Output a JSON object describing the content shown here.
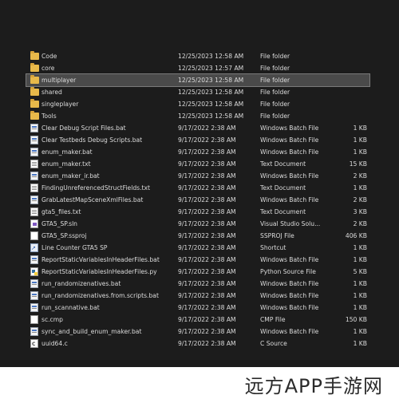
{
  "files": [
    {
      "name": "Code",
      "date": "12/25/2023 12:58 AM",
      "type": "File folder",
      "size": "",
      "icon": "folder-icon"
    },
    {
      "name": "core",
      "date": "12/25/2023 12:57 AM",
      "type": "File folder",
      "size": "",
      "icon": "folder-icon"
    },
    {
      "name": "multiplayer",
      "date": "12/25/2023 12:58 AM",
      "type": "File folder",
      "size": "",
      "icon": "folder-icon",
      "selected": true
    },
    {
      "name": "shared",
      "date": "12/25/2023 12:58 AM",
      "type": "File folder",
      "size": "",
      "icon": "folder-icon"
    },
    {
      "name": "singleplayer",
      "date": "12/25/2023 12:58 AM",
      "type": "File folder",
      "size": "",
      "icon": "folder-icon"
    },
    {
      "name": "Tools",
      "date": "12/25/2023 12:58 AM",
      "type": "File folder",
      "size": "",
      "icon": "folder-icon"
    },
    {
      "name": "Clear Debug Script Files.bat",
      "date": "9/17/2022 2:38 AM",
      "type": "Windows Batch File",
      "size": "1 KB",
      "icon": "batch-file-icon"
    },
    {
      "name": "Clear Testbeds Debug Scripts.bat",
      "date": "9/17/2022 2:38 AM",
      "type": "Windows Batch File",
      "size": "1 KB",
      "icon": "batch-file-icon"
    },
    {
      "name": "enum_maker.bat",
      "date": "9/17/2022 2:38 AM",
      "type": "Windows Batch File",
      "size": "1 KB",
      "icon": "batch-file-icon"
    },
    {
      "name": "enum_maker.txt",
      "date": "9/17/2022 2:38 AM",
      "type": "Text Document",
      "size": "15 KB",
      "icon": "text-file-icon"
    },
    {
      "name": "enum_maker_ir.bat",
      "date": "9/17/2022 2:38 AM",
      "type": "Windows Batch File",
      "size": "2 KB",
      "icon": "batch-file-icon"
    },
    {
      "name": "FindingUnreferencedStructFields.txt",
      "date": "9/17/2022 2:38 AM",
      "type": "Text Document",
      "size": "1 KB",
      "icon": "text-file-icon"
    },
    {
      "name": "GrabLatestMapSceneXmlFiles.bat",
      "date": "9/17/2022 2:38 AM",
      "type": "Windows Batch File",
      "size": "2 KB",
      "icon": "batch-file-icon"
    },
    {
      "name": "gta5_files.txt",
      "date": "9/17/2022 2:38 AM",
      "type": "Text Document",
      "size": "3 KB",
      "icon": "text-file-icon"
    },
    {
      "name": "GTA5_SP.sln",
      "date": "9/17/2022 2:38 AM",
      "type": "Visual Studio Solu...",
      "size": "2 KB",
      "icon": "solution-file-icon"
    },
    {
      "name": "GTA5_SP.ssproj",
      "date": "9/17/2022 2:38 AM",
      "type": "SSPROJ File",
      "size": "406 KB",
      "icon": "ssproj-file-icon"
    },
    {
      "name": "Line Counter GTA5 SP",
      "date": "9/17/2022 2:38 AM",
      "type": "Shortcut",
      "size": "1 KB",
      "icon": "shortcut-icon"
    },
    {
      "name": "ReportStaticVariablesInHeaderFiles.bat",
      "date": "9/17/2022 2:38 AM",
      "type": "Windows Batch File",
      "size": "1 KB",
      "icon": "batch-file-icon"
    },
    {
      "name": "ReportStaticVariablesInHeaderFiles.py",
      "date": "9/17/2022 2:38 AM",
      "type": "Python Source File",
      "size": "5 KB",
      "icon": "python-file-icon"
    },
    {
      "name": "run_randomizenatives.bat",
      "date": "9/17/2022 2:38 AM",
      "type": "Windows Batch File",
      "size": "1 KB",
      "icon": "batch-file-icon"
    },
    {
      "name": "run_randomizenatives.from.scripts.bat",
      "date": "9/17/2022 2:38 AM",
      "type": "Windows Batch File",
      "size": "1 KB",
      "icon": "batch-file-icon"
    },
    {
      "name": "run_scannative.bat",
      "date": "9/17/2022 2:38 AM",
      "type": "Windows Batch File",
      "size": "1 KB",
      "icon": "batch-file-icon"
    },
    {
      "name": "sc.cmp",
      "date": "9/17/2022 2:38 AM",
      "type": "CMP File",
      "size": "150 KB",
      "icon": "cmp-file-icon"
    },
    {
      "name": "sync_and_build_enum_maker.bat",
      "date": "9/17/2022 2:38 AM",
      "type": "Windows Batch File",
      "size": "1 KB",
      "icon": "batch-file-icon"
    },
    {
      "name": "uuid64.c",
      "date": "9/17/2022 2:38 AM",
      "type": "C Source",
      "size": "1 KB",
      "icon": "c-source-file-icon"
    }
  ],
  "watermark": {
    "text": "远方APP手游网"
  },
  "colors": {
    "background": "#1c1c1c",
    "text": "#dcdcdc",
    "selected_row": "#4a4a4a",
    "folder": "#e8b94a"
  }
}
